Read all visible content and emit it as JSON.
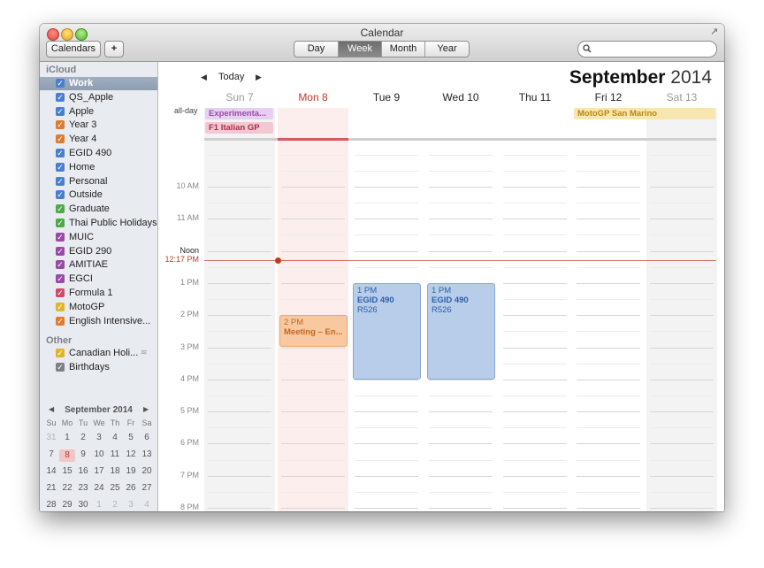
{
  "window": {
    "title": "Calendar"
  },
  "toolbar": {
    "calendars_label": "Calendars",
    "add_label": "+",
    "views": [
      "Day",
      "Week",
      "Month",
      "Year"
    ],
    "active_view": "Week",
    "search_placeholder": ""
  },
  "sidebar": {
    "icloud_header": "iCloud",
    "icloud_items": [
      {
        "label": "Work",
        "color": "#4a7fd0",
        "selected": true
      },
      {
        "label": "QS_Apple",
        "color": "#4a7fd0"
      },
      {
        "label": "Apple",
        "color": "#4a7fd0"
      },
      {
        "label": "Year 3",
        "color": "#e07c2f"
      },
      {
        "label": "Year 4",
        "color": "#e07c2f"
      },
      {
        "label": "EGID 490",
        "color": "#4a7fd0"
      },
      {
        "label": "Home",
        "color": "#4a7fd0"
      },
      {
        "label": "Personal",
        "color": "#4a7fd0"
      },
      {
        "label": "Outside",
        "color": "#4a7fd0"
      },
      {
        "label": "Graduate",
        "color": "#4fa94a"
      },
      {
        "label": "Thai Public Holidays",
        "color": "#4fa94a"
      },
      {
        "label": "MUIC",
        "color": "#9a4aa8"
      },
      {
        "label": "EGID 290",
        "color": "#9a4aa8"
      },
      {
        "label": "AMITIAE",
        "color": "#9a4aa8"
      },
      {
        "label": "EGCI",
        "color": "#9a4aa8"
      },
      {
        "label": "Formula 1",
        "color": "#d24a6a"
      },
      {
        "label": "MotoGP",
        "color": "#e0b42a"
      },
      {
        "label": "English Intensive...",
        "color": "#e07c2f"
      }
    ],
    "other_header": "Other",
    "other_items": [
      {
        "label": "Canadian Holi...",
        "color": "#e0b42a"
      },
      {
        "label": "Birthdays",
        "color": "#7c8188"
      }
    ]
  },
  "mini_calendar": {
    "title": "September 2014",
    "weekdays": [
      "Su",
      "Mo",
      "Tu",
      "We",
      "Th",
      "Fr",
      "Sa"
    ],
    "rows": [
      [
        "31",
        "1",
        "2",
        "3",
        "4",
        "5",
        "6"
      ],
      [
        "7",
        "8",
        "9",
        "10",
        "11",
        "12",
        "13"
      ],
      [
        "14",
        "15",
        "16",
        "17",
        "18",
        "19",
        "20"
      ],
      [
        "21",
        "22",
        "23",
        "24",
        "25",
        "26",
        "27"
      ],
      [
        "28",
        "29",
        "30",
        "1",
        "2",
        "3",
        "4"
      ]
    ],
    "today": "8"
  },
  "main": {
    "today_label": "Today",
    "month_name": "September",
    "year": "2014",
    "days": [
      {
        "label": "Sun 7",
        "weekend": true
      },
      {
        "label": "Mon 8",
        "today": true
      },
      {
        "label": "Tue 9"
      },
      {
        "label": "Wed 10"
      },
      {
        "label": "Thu 11"
      },
      {
        "label": "Fri 12"
      },
      {
        "label": "Sat 13",
        "weekend": true
      }
    ],
    "allday_label": "all-day",
    "hours": [
      "10 AM",
      "11 AM",
      "Noon",
      "1 PM",
      "2 PM",
      "3 PM",
      "4 PM",
      "5 PM",
      "6 PM",
      "7 PM",
      "8 PM"
    ],
    "current_time": "12:17 PM",
    "allday_events": [
      {
        "title": "Experimenta...",
        "day": 0,
        "color": "#9a4aa8",
        "bg": "#e7cff0"
      },
      {
        "title": "F1 Italian GP",
        "day": 0,
        "color": "#b02a4a",
        "bg": "#f3c8d2"
      },
      {
        "title": "MotoGP San Marino",
        "day": 5,
        "color": "#b8871a",
        "bg": "#f7e6b0"
      }
    ],
    "events": [
      {
        "time": "2 PM",
        "title": "Meeting – En...",
        "room": "",
        "day": 1,
        "start": 14,
        "end": 15,
        "color": "#c8641e",
        "bg": "#f8c9a0"
      },
      {
        "time": "1 PM",
        "title": "EGID 490",
        "room": "R526",
        "day": 2,
        "start": 13,
        "end": 16,
        "color": "#2f5fa8",
        "bg": "#b7cdea"
      },
      {
        "time": "1 PM",
        "title": "EGID 490",
        "room": "R526",
        "day": 3,
        "start": 13,
        "end": 16,
        "color": "#2f5fa8",
        "bg": "#b7cdea"
      }
    ]
  }
}
